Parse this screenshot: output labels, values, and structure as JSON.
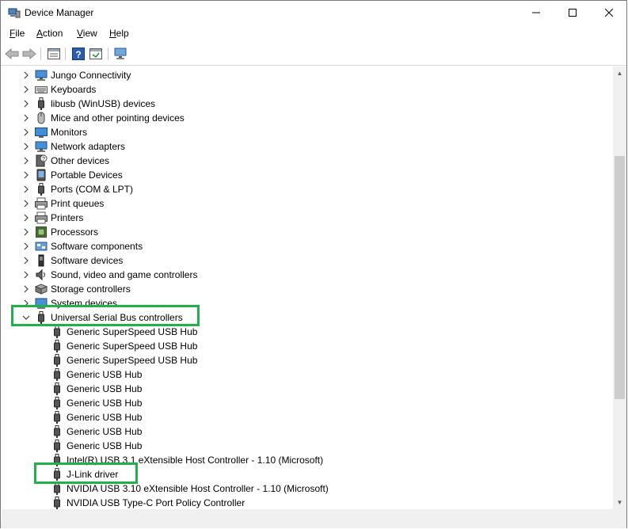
{
  "window": {
    "title": "Device Manager",
    "title_icon": "device-manager-icon",
    "controls": [
      "minimize",
      "maximize",
      "close"
    ]
  },
  "menu": [
    {
      "label": "File",
      "key": "F"
    },
    {
      "label": "Action",
      "key": "A"
    },
    {
      "label": "View",
      "key": "V"
    },
    {
      "label": "Help",
      "key": "H"
    }
  ],
  "toolbar": [
    "back-icon",
    "forward-icon",
    "properties-icon",
    "help-icon",
    "update-driver-icon",
    "scan-hardware-icon"
  ],
  "categories": [
    {
      "label": "Jungo Connectivity",
      "icon": "network-icon",
      "expanded": false
    },
    {
      "label": "Keyboards",
      "icon": "keyboard-icon",
      "expanded": false
    },
    {
      "label": "libusb (WinUSB) devices",
      "icon": "usb-icon",
      "expanded": false
    },
    {
      "label": "Mice and other pointing devices",
      "icon": "mouse-icon",
      "expanded": false
    },
    {
      "label": "Monitors",
      "icon": "monitor-icon",
      "expanded": false
    },
    {
      "label": "Network adapters",
      "icon": "network-icon",
      "expanded": false
    },
    {
      "label": "Other devices",
      "icon": "unknown-device-icon",
      "expanded": false
    },
    {
      "label": "Portable Devices",
      "icon": "portable-device-icon",
      "expanded": false
    },
    {
      "label": "Ports (COM & LPT)",
      "icon": "port-icon",
      "expanded": false
    },
    {
      "label": "Print queues",
      "icon": "printer-icon",
      "expanded": false
    },
    {
      "label": "Printers",
      "icon": "printer-icon",
      "expanded": false
    },
    {
      "label": "Processors",
      "icon": "processor-icon",
      "expanded": false
    },
    {
      "label": "Software components",
      "icon": "software-component-icon",
      "expanded": false
    },
    {
      "label": "Software devices",
      "icon": "software-device-icon",
      "expanded": false
    },
    {
      "label": "Sound, video and game controllers",
      "icon": "speaker-icon",
      "expanded": false
    },
    {
      "label": "Storage controllers",
      "icon": "storage-icon",
      "expanded": false
    },
    {
      "label": "System devices",
      "icon": "system-device-icon",
      "expanded": false
    },
    {
      "label": "Universal Serial Bus controllers",
      "icon": "usb-icon",
      "expanded": true
    }
  ],
  "usb_children": [
    "Generic SuperSpeed USB Hub",
    "Generic SuperSpeed USB Hub",
    "Generic SuperSpeed USB Hub",
    "Generic USB Hub",
    "Generic USB Hub",
    "Generic USB Hub",
    "Generic USB Hub",
    "Generic USB Hub",
    "Generic USB Hub",
    "Intel(R) USB 3.1 eXtensible Host Controller - 1.10 (Microsoft)",
    "J-Link driver",
    "NVIDIA USB 3.10 eXtensible Host Controller - 1.10 (Microsoft)",
    "NVIDIA USB Type-C Port Policy Controller"
  ],
  "highlight_color": "#22b04a"
}
